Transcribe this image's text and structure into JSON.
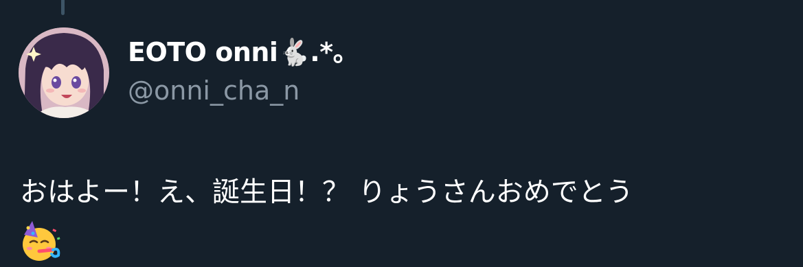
{
  "tweet": {
    "display_name": "EOTO onni🐇.*。",
    "handle": "@onni_cha_n",
    "text": "おはよー！え、誕生日！？ りょうさんおめでとう",
    "emoji": "🥳"
  },
  "colors": {
    "background": "#15202b",
    "name_text": "#ffffff",
    "handle_text": "#8b98a5",
    "thread_line": "#3d5466"
  },
  "icons": {
    "avatar": "anime-girl-avatar",
    "party-face": "partying-face-icon"
  }
}
